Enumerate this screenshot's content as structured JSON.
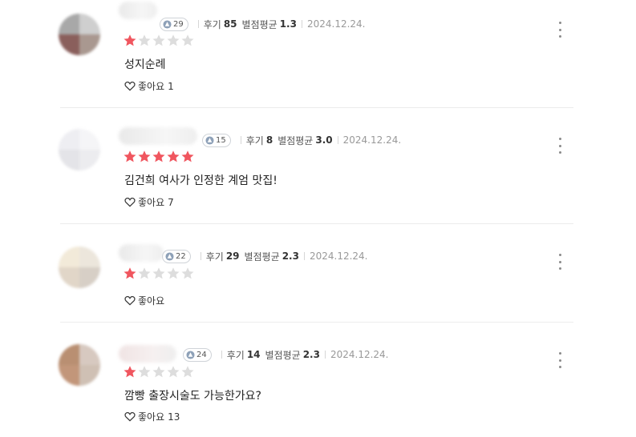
{
  "labels": {
    "reviews": "후기",
    "avg_rating": "별점평균",
    "like": "좋아요"
  },
  "colors": {
    "star_filled": "#f0565f",
    "star_empty": "#dddddd"
  },
  "reviews": [
    {
      "level": "29",
      "review_count": "85",
      "avg_rating": "1.3",
      "date": "2024.12.24.",
      "stars": 1,
      "text": "성지순례",
      "likes": "1"
    },
    {
      "level": "15",
      "review_count": "8",
      "avg_rating": "3.0",
      "date": "2024.12.24.",
      "stars": 5,
      "text": "김건희 여사가 인정한 계엄 맛집!",
      "likes": "7"
    },
    {
      "level": "22",
      "review_count": "29",
      "avg_rating": "2.3",
      "date": "2024.12.24.",
      "stars": 1,
      "text": "",
      "likes": ""
    },
    {
      "level": "24",
      "review_count": "14",
      "avg_rating": "2.3",
      "date": "2024.12.24.",
      "stars": 1,
      "text": "깜빵  출장시술도 가능한가요?",
      "likes": "13"
    }
  ]
}
